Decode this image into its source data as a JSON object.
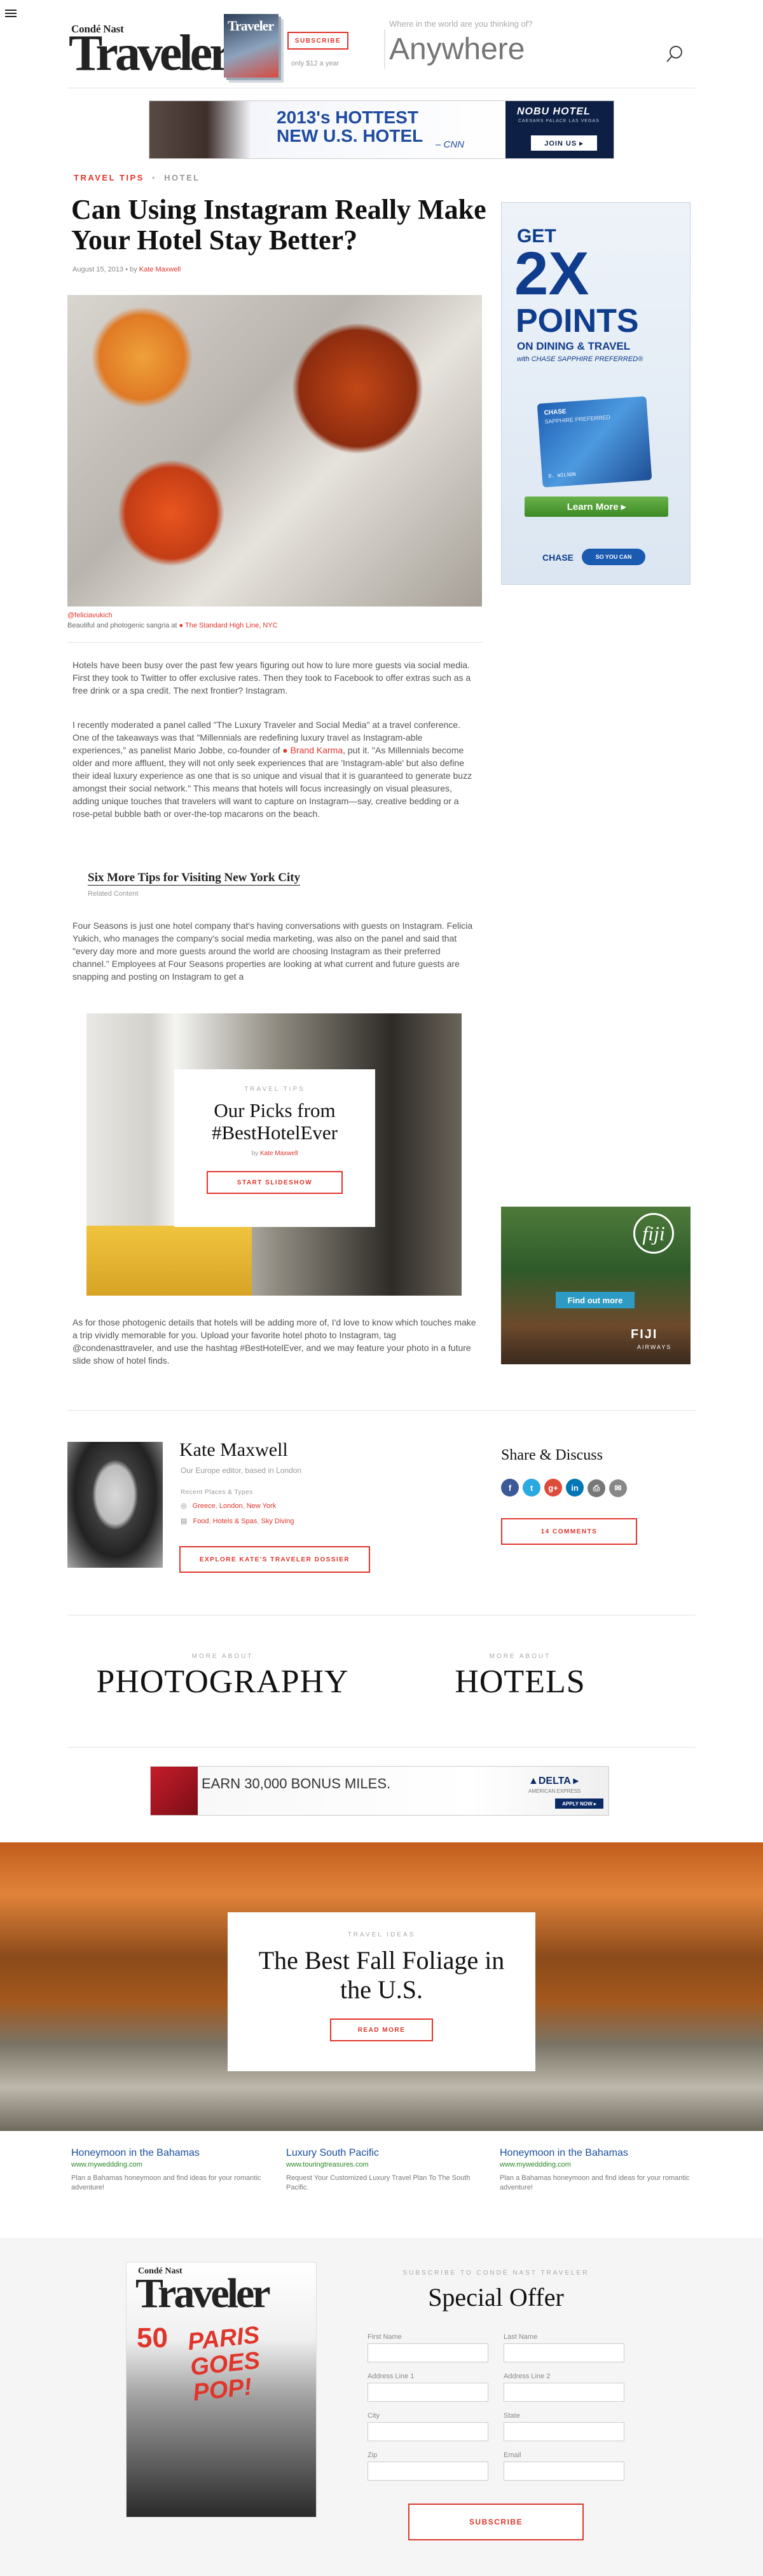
{
  "header": {
    "brand_top": "Condé Nast",
    "brand_main": "Traveler",
    "mag_mini_title": "Traveler",
    "subscribe_label": "SUBSCRIBE",
    "subscribe_sub": "only $12 a year",
    "search_question": "Where in the world are you thinking of?",
    "search_placeholder": "Anywhere"
  },
  "top_ad": {
    "headline": "2013's HOTTEST NEW U.S. HOTEL",
    "source": "– CNN",
    "brand": "NOBU HOTEL",
    "brand_sub": "CAESARS PALACE LAS VEGAS",
    "cta": "JOIN US ▸"
  },
  "article": {
    "crumb_primary": "TRAVEL TIPS",
    "crumb_sep": "•",
    "crumb_secondary": "HOTEL",
    "title": "Can Using Instagram Really Make Your Hotel Stay Better?",
    "date": "August 15, 2013",
    "by": "• by",
    "author": "Kate Maxwell",
    "photo_credit": "@feliciavukich",
    "caption_text": "Beautiful and photogenic sangria at",
    "caption_link": "The Standard High Line, NYC",
    "p1": "Hotels have been busy over the past few years figuring out how to lure more guests via social media. First they took to Twitter to offer exclusive rates. Then they took to Facebook to offer extras such as a free drink or a spa credit. The next frontier? Instagram.",
    "p2a": "I recently moderated a panel called \"The Luxury Traveler and Social Media\" at a travel conference. One of the takeaways was that \"Millennials are redefining luxury travel as Instagram-able experiences,\" as panelist Mario Jobbe, co-founder of",
    "p2_link": "Brand Karma",
    "p2b": ", put it. \"As Millennials become older and more affluent, they will not only seek experiences that are 'Instagram-able' but also define their ideal luxury experience as one that is so unique and visual that it is guaranteed to generate buzz amongst their social network.\" This means that hotels will focus increasingly on visual pleasures, adding unique touches that travelers will want to capture on Instagram—say, creative bedding or a rose-petal bubble bath or over-the-top macarons on the beach.",
    "related_title": "Six More Tips for Visiting New York City",
    "related_sub": "Related Content",
    "p3": "Four Seasons is just one hotel company that's having conversations with guests on Instagram. Felicia Yukich, who manages the company's social media marketing, was also on the panel and said that \"every day more and more guests around the world are choosing Instagram as their preferred channel.\" Employees at Four Seasons properties are looking at what current and future guests are snapping and posting on Instagram to get a",
    "p4": "As for those photogenic details that hotels will be adding more of, I'd love to know which touches make a trip vividly memorable for you. Upload your favorite hotel photo to Instagram, tag @condenasttraveler, and use the hashtag #BestHotelEver, and we may feature your photo in a future slide show of hotel finds."
  },
  "slideshow": {
    "kicker": "TRAVEL TIPS",
    "title": "Our Picks from #BestHotelEver",
    "by": "by",
    "author": "Kate Maxwell",
    "cta": "START SLIDESHOW"
  },
  "right_ad": {
    "get": "GET",
    "big": "2X",
    "points": "POINTS",
    "on": "ON DINING & TRAVEL",
    "with": "with CHASE SAPPHIRE PREFERRED®",
    "card_brand": "CHASE",
    "card_name": "SAPPHIRE PREFERRED",
    "card_holder": "D. WILSON",
    "learn": "Learn More ▸",
    "chase": "CHASE",
    "soyoucan": "SO YOU CAN"
  },
  "fiji_ad": {
    "logo": "fiji",
    "cta": "Find out more",
    "brand": "FIJI",
    "brand_sub": "AIRWAYS"
  },
  "author_box": {
    "name": "Kate Maxwell",
    "role": "Our Europe editor, based in London",
    "recent_label": "Recent Places & Types",
    "places": [
      "Greece",
      "London",
      "New York"
    ],
    "types": [
      "Food",
      "Hotels & Spas",
      "Sky Diving"
    ],
    "dossier_cta": "EXPLORE KATE'S TRAVELER DOSSIER"
  },
  "share": {
    "title": "Share & Discuss",
    "icons": [
      "f",
      "t",
      "g+",
      "in",
      "⎙",
      "✉"
    ],
    "icon_colors": [
      "#3b5998",
      "#2ba9e1",
      "#dd4b39",
      "#0077b5",
      "#777777",
      "#888888"
    ],
    "comments": "14 COMMENTS"
  },
  "more_about": {
    "label": "MORE ABOUT",
    "left": "PHOTOGRAPHY",
    "right": "HOTELS"
  },
  "delta_ad": {
    "text": "EARN 30,000 BONUS MILES.",
    "brand": "▲DELTA ▸",
    "sub": "AMERICAN EXPRESS",
    "cta": "APPLY NOW ▸"
  },
  "fall": {
    "kicker": "TRAVEL IDEAS",
    "title": "The Best Fall Foliage in the U.S.",
    "cta": "READ MORE"
  },
  "promos": [
    {
      "title": "Honeymoon in the Bahamas",
      "url": "www.myweddding.com",
      "desc": "Plan a Bahamas honeymoon and find ideas for your romantic adventure!"
    },
    {
      "title": "Luxury South Pacific",
      "url": "www.touringtreasures.com",
      "desc": "Request Your Customized Luxury Travel Plan To The South Pacific."
    },
    {
      "title": "Honeymoon in the Bahamas",
      "url": "www.myweddding.com",
      "desc": "Plan a Bahamas honeymoon and find ideas for your romantic adventure!"
    }
  ],
  "subscribe": {
    "kicker": "SUBSCRIBE TO CONDÉ NAST TRAVELER",
    "title": "Special Offer",
    "mag_top": "Condé Nast",
    "mag_main": "Traveler",
    "mag_cover_line": "PARIS GOES POP!",
    "mag_num": "50",
    "fields": {
      "first": "First Name",
      "last": "Last Name",
      "addr1": "Address Line 1",
      "addr2": "Address Line 2",
      "city": "City",
      "state": "State",
      "zip": "Zip",
      "email": "Email"
    },
    "cta": "SUBSCRIBE"
  }
}
